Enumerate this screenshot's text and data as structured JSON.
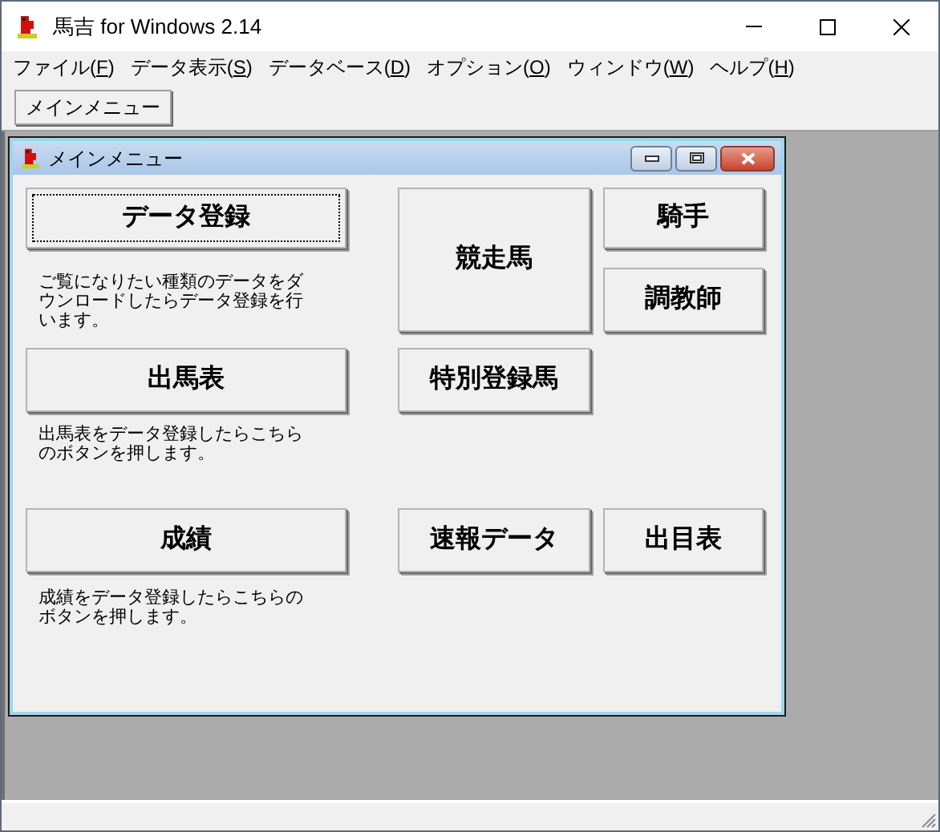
{
  "window": {
    "title": "馬吉 for Windows 2.14"
  },
  "menu": [
    {
      "label": "ファイル(F)"
    },
    {
      "label": "データ表示(S)"
    },
    {
      "label": "データベース(D)"
    },
    {
      "label": "オプション(O)"
    },
    {
      "label": "ウィンドウ(W)"
    },
    {
      "label": "ヘルプ(H)"
    }
  ],
  "toolbar": {
    "buttons": [
      "メインメニュー"
    ]
  },
  "child_window": {
    "title": "メインメニュー",
    "buttons": [
      {
        "label": "データ登録",
        "focused": true
      },
      {
        "label": "競走馬",
        "focused": false
      },
      {
        "label": "騎手",
        "focused": false
      },
      {
        "label": "調教師",
        "focused": false
      },
      {
        "label": "出馬表",
        "focused": false
      },
      {
        "label": "特別登録馬",
        "focused": false
      },
      {
        "label": "成績",
        "focused": false
      },
      {
        "label": "速報データ",
        "focused": false
      },
      {
        "label": "出目表",
        "focused": false
      }
    ],
    "descriptions": [
      "ご覧になりたい種類のデータをダウンロードしたらデータ登録を行います。",
      "出馬表をデータ登録したらこちらのボタンを押します。",
      "成績をデータ登録したらこちらのボタンを押します。"
    ]
  }
}
